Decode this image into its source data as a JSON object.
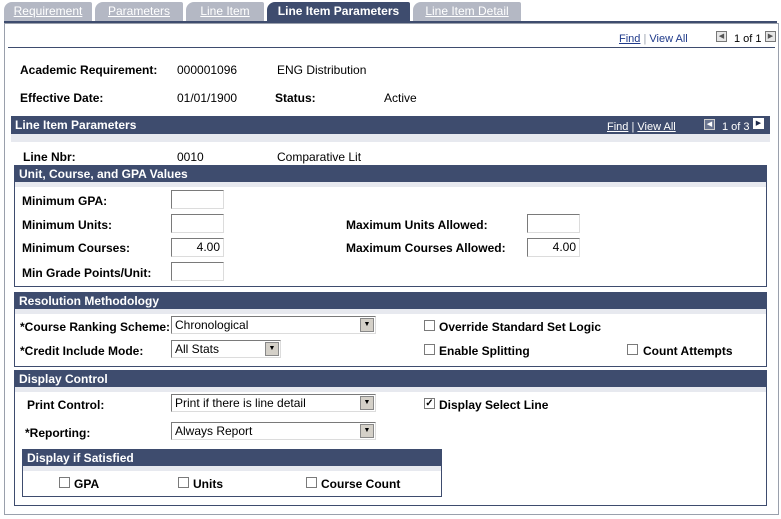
{
  "tabs": [
    {
      "label": "Requirement"
    },
    {
      "label": "Parameters"
    },
    {
      "label": "Line Item"
    },
    {
      "label": "Line Item Parameters"
    },
    {
      "label": "Line Item Detail"
    }
  ],
  "top_nav": {
    "find": "Find",
    "sep": "|",
    "view_all": "View All",
    "count": "1 of 1"
  },
  "header": {
    "acad_req_label": "Academic Requirement:",
    "acad_req_value": "000001096",
    "acad_req_desc": "ENG Distribution",
    "eff_date_label": "Effective Date:",
    "eff_date_value": "01/01/1900",
    "status_label": "Status:",
    "status_value": "Active"
  },
  "line_item_params": {
    "title": "Line Item Parameters",
    "find": "Find",
    "sep": "|",
    "view_all": "View All",
    "count": "1 of 3",
    "line_nbr_label": "Line Nbr:",
    "line_nbr_value": "0010",
    "line_nbr_desc": "Comparative Lit"
  },
  "unit_course_gpa": {
    "title": "Unit, Course, and GPA Values",
    "min_gpa_label": "Minimum GPA:",
    "min_gpa_value": "",
    "min_units_label": "Minimum Units:",
    "min_units_value": "",
    "max_units_label": "Maximum Units Allowed:",
    "max_units_value": "",
    "min_courses_label": "Minimum Courses:",
    "min_courses_value": "4.00",
    "max_courses_label": "Maximum Courses Allowed:",
    "max_courses_value": "4.00",
    "min_grade_points_label": "Min Grade Points/Unit:",
    "min_grade_points_value": ""
  },
  "resolution": {
    "title": "Resolution Methodology",
    "ranking_label": "*Course Ranking Scheme:",
    "ranking_value": "Chronological",
    "credit_label": "*Credit Include Mode:",
    "credit_value": "All Stats",
    "override_label": "Override Standard Set Logic",
    "override_checked": false,
    "splitting_label": "Enable Splitting",
    "splitting_checked": false,
    "count_attempts_label": "Count Attempts",
    "count_attempts_checked": false
  },
  "display_control": {
    "title": "Display Control",
    "print_label": "Print Control:",
    "print_value": "Print if there is line detail",
    "reporting_label": "*Reporting:",
    "reporting_value": "Always Report",
    "display_select_label": "Display Select Line",
    "display_select_checked": true,
    "check_mark": "✓",
    "satisfied": {
      "title": "Display if Satisfied",
      "gpa_label": "GPA",
      "units_label": "Units",
      "course_count_label": "Course Count"
    }
  }
}
